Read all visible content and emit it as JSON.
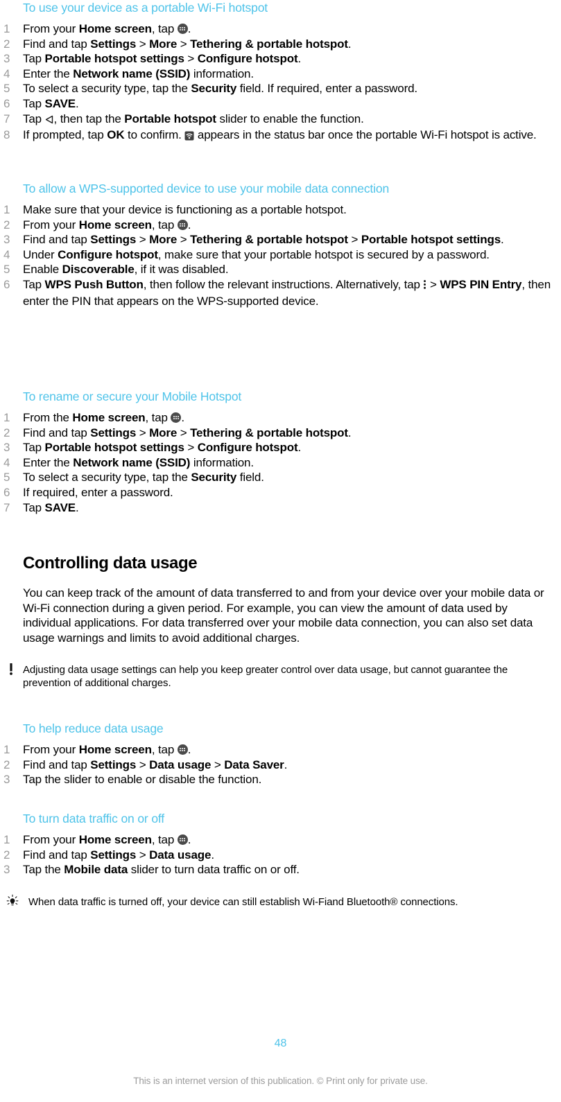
{
  "colors": {
    "heading_blue": "#4ec3e9",
    "step_number_gray": "#9a9a9a",
    "body_black": "#000000",
    "footer_gray": "#9a9a9a",
    "icon_dark": "#4a4a4a"
  },
  "sections": [
    {
      "id": "portable-wifi-hotspot",
      "heading": "To use your device as a portable Wi-Fi hotspot",
      "steps": [
        "From your Home screen, tap [app-drawer-icon].",
        "Find and tap Settings > More > Tethering & portable hotspot.",
        "Tap Portable hotspot settings > Configure hotspot.",
        "Enter the Network name (SSID) information.",
        "To select a security type, tap the Security field. If required, enter a password.",
        "Tap SAVE.",
        "Tap [back-icon], then tap the Portable hotspot slider to enable the function.",
        "If prompted, tap OK to confirm. [hotspot-status-icon] appears in the status bar once the portable Wi-Fi hotspot is active."
      ]
    },
    {
      "id": "wps-supported-device",
      "heading": "To allow a WPS-supported device to use your mobile data connection",
      "steps": [
        "Make sure that your device is functioning as a portable hotspot.",
        "From your Home screen, tap [app-drawer-icon].",
        "Find and tap Settings > More > Tethering & portable hotspot > Portable hotspot settings.",
        "Under Configure hotspot, make sure that your portable hotspot is secured by a password.",
        "Enable Discoverable, if it was disabled.",
        "Tap WPS Push Button, then follow the relevant instructions. Alternatively, tap [kebab-menu-icon] > WPS PIN Entry, then enter the PIN that appears on the WPS-supported device."
      ]
    },
    {
      "id": "rename-secure-mobile-hotspot",
      "heading": "To rename or secure your Mobile Hotspot",
      "steps": [
        "From the Home screen, tap [app-drawer-icon].",
        "Find and tap Settings > More > Tethering & portable hotspot.",
        "Tap Portable hotspot settings > Configure hotspot.",
        "Enter the Network name (SSID) information.",
        "To select a security type, tap the Security field.",
        "If required, enter a password.",
        "Tap SAVE."
      ]
    }
  ],
  "chapter": {
    "heading": "Controlling data usage",
    "intro": "You can keep track of the amount of data transferred to and from your device over your mobile data or Wi-Fi connection during a given period. For example, you can view the amount of data used by individual applications. For data transferred over your mobile data connection, you can also set data usage warnings and limits to avoid additional charges.",
    "warning_note": "Adjusting data usage settings can help you keep greater control over data usage, but cannot guarantee the prevention of additional charges."
  },
  "sections2": [
    {
      "id": "help-reduce-data-usage",
      "heading": "To help reduce data usage",
      "steps": [
        "From your Home screen, tap [app-drawer-icon].",
        "Find and tap Settings > Data usage > Data Saver.",
        "Tap the slider to enable or disable the function."
      ]
    },
    {
      "id": "turn-data-traffic-on-off",
      "heading": "To turn data traffic on or off",
      "steps": [
        "From your Home screen, tap [app-drawer-icon].",
        "Find and tap Settings > Data usage.",
        "Tap the Mobile data slider to turn data traffic on or off."
      ]
    }
  ],
  "tip_note": "When data traffic is turned off, your device can still establish Wi-Fiand Bluetooth® connections.",
  "footer": {
    "page_number": "48",
    "disclaimer": "This is an internet version of this publication. © Print only for private use."
  },
  "inline": {
    "s1": {
      "p1a": "From your ",
      "p1b": "Home screen",
      "p1c": ", tap ",
      "p1d": ".",
      "p2a": "Find and tap ",
      "p2b": "Settings",
      "p2c": " > ",
      "p2d": "More",
      "p2e": " > ",
      "p2f": "Tethering & portable hotspot",
      "p2g": ".",
      "p3a": "Tap ",
      "p3b": "Portable hotspot settings",
      "p3c": " > ",
      "p3d": "Configure hotspot",
      "p3e": ".",
      "p4a": "Enter the ",
      "p4b": "Network name (SSID)",
      "p4c": " information.",
      "p5a": "To select a security type, tap the ",
      "p5b": "Security",
      "p5c": " field. If required, enter a password.",
      "p6a": "Tap ",
      "p6b": "SAVE",
      "p6c": ".",
      "p7a": "Tap ",
      "p7b": ", then tap the ",
      "p7c": "Portable hotspot",
      "p7d": " slider to enable the function.",
      "p8a": "If prompted, tap ",
      "p8b": "OK",
      "p8c": " to confirm. ",
      "p8d": " appears in the status bar once the portable Wi-Fi hotspot is active."
    },
    "s2": {
      "p1": "Make sure that your device is functioning as a portable hotspot.",
      "p2a": "From your ",
      "p2b": "Home screen",
      "p2c": ", tap ",
      "p2d": ".",
      "p3a": "Find and tap ",
      "p3b": "Settings",
      "p3c": " > ",
      "p3d": "More",
      "p3e": " > ",
      "p3f": "Tethering & portable hotspot",
      "p3g": " > ",
      "p3h": "Portable hotspot settings",
      "p3i": ".",
      "p4a": "Under ",
      "p4b": "Configure hotspot",
      "p4c": ", make sure that your portable hotspot is secured by a password.",
      "p5a": "Enable ",
      "p5b": "Discoverable",
      "p5c": ", if it was disabled.",
      "p6a": "Tap ",
      "p6b": "WPS Push Button",
      "p6c": ", then follow the relevant instructions. Alternatively, tap ",
      "p6d": " > ",
      "p6e": "WPS PIN Entry",
      "p6f": ", then enter the PIN that appears on the WPS-supported device."
    },
    "s3": {
      "p1a": "From the ",
      "p1b": "Home screen",
      "p1c": ", tap ",
      "p1d": ".",
      "p2a": "Find and tap ",
      "p2b": "Settings",
      "p2c": " > ",
      "p2d": "More",
      "p2e": " > ",
      "p2f": "Tethering & portable hotspot",
      "p2g": ".",
      "p3a": "Tap ",
      "p3b": "Portable hotspot settings",
      "p3c": " > ",
      "p3d": "Configure hotspot",
      "p3e": ".",
      "p4a": "Enter the ",
      "p4b": "Network name (SSID)",
      "p4c": " information.",
      "p5a": "To select a security type, tap the ",
      "p5b": "Security",
      "p5c": " field.",
      "p6": "If required, enter a password.",
      "p7a": "Tap ",
      "p7b": "SAVE",
      "p7c": "."
    },
    "s4": {
      "p1a": "From your ",
      "p1b": "Home screen",
      "p1c": ", tap ",
      "p1d": ".",
      "p2a": "Find and tap ",
      "p2b": "Settings",
      "p2c": " > ",
      "p2d": "Data usage",
      "p2e": " > ",
      "p2f": "Data Saver",
      "p2g": ".",
      "p3": "Tap the slider to enable or disable the function."
    },
    "s5": {
      "p1a": "From your ",
      "p1b": "Home screen",
      "p1c": ", tap ",
      "p1d": ".",
      "p2a": "Find and tap ",
      "p2b": "Settings",
      "p2c": " > ",
      "p2d": "Data usage",
      "p2e": ".",
      "p3a": "Tap the ",
      "p3b": "Mobile data",
      "p3c": " slider to turn data traffic on or off."
    }
  }
}
